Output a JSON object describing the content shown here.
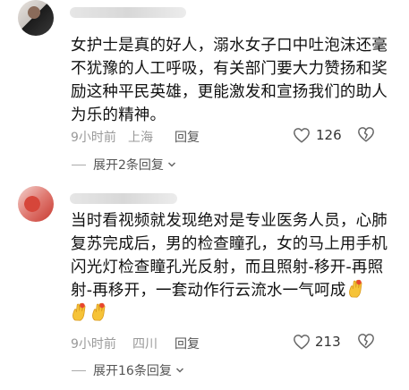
{
  "comments": [
    {
      "text": "女护士是真的好人，溺水女子口中吐泡沫还毫不犹豫的人工呼吸，有关部门要大力赞扬和奖励这种平民英雄，更能激发和宣扬我们的助人为乐的精神。",
      "time": "9小时前",
      "location": "上海",
      "reply_label": "回复",
      "likes": "126",
      "expand_label": "展开2条回复"
    },
    {
      "text": "当时看视频就发现绝对是专业医务人员，心肺复苏完成后，男的检查瞳孔，女的马上用手机闪光灯检查瞳孔光反射，而且照射-移开-再照射-再移开，一套动作行云流水一气呵成",
      "time": "9小时前",
      "location": "四川",
      "reply_label": "回复",
      "likes": "213",
      "expand_label": "展开16条回复"
    }
  ],
  "icons": {
    "like": "heart-outline-icon",
    "dislike": "broken-heart-icon",
    "expand": "chevron-down-icon",
    "emoji": "ok-hand-emoji"
  },
  "colors": {
    "meta_text": "#9a9a9a",
    "emoji_yellow": "#f6c338"
  }
}
